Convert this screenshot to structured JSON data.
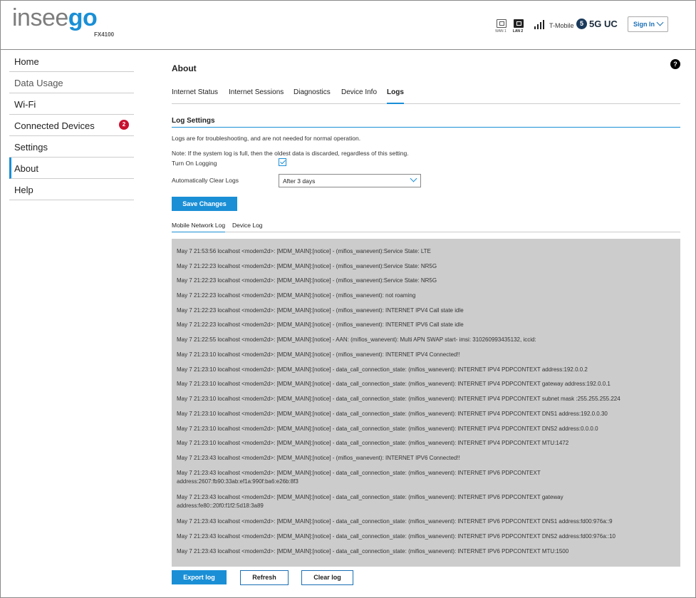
{
  "header": {
    "logo_part1": "insee",
    "logo_part2": "go",
    "model": "FX4100",
    "wan_label": "WAN 1",
    "lan_label": "LAN 2",
    "carrier": "T-Mobile",
    "network_icon_text": "5",
    "network_type": "5G UC",
    "sign_in": "Sign In"
  },
  "sidebar": {
    "items": [
      {
        "label": "Home"
      },
      {
        "label": "Data Usage"
      },
      {
        "label": "Wi-Fi"
      },
      {
        "label": "Connected Devices",
        "badge": "2"
      },
      {
        "label": "Settings"
      },
      {
        "label": "About"
      },
      {
        "label": "Help"
      }
    ]
  },
  "main": {
    "title": "About",
    "help": "?",
    "tabs": [
      "Internet Status",
      "Internet Sessions",
      "Diagnostics",
      "Device Info",
      "Logs"
    ],
    "section_title": "Log Settings",
    "note1": "Logs are for troubleshooting, and are not needed for normal operation.",
    "note2": "Note: If the system log is full, then the oldest data is discarded, regardless of this setting.",
    "logging_label": "Turn On Logging",
    "clear_label": "Automatically Clear Logs",
    "clear_value": "After 3 days",
    "save_button": "Save Changes",
    "log_tabs": [
      "Mobile Network Log",
      "Device Log"
    ],
    "log_lines": [
      "May 7 21:53:56 localhost <modem2d>: [MDM_MAIN]:[notice] - (mifios_wanevent):Service State: LTE",
      "May 7 21:22:23 localhost <modem2d>: [MDM_MAIN]:[notice] - (mifios_wanevent):Service State: NR5G",
      "May 7 21:22:23 localhost <modem2d>: [MDM_MAIN]:[notice] - (mifios_wanevent):Service State: NR5G",
      "May 7 21:22:23 localhost <modem2d>: [MDM_MAIN]:[notice] - (mifios_wanevent): not roaming",
      "May 7 21:22:23 localhost <modem2d>: [MDM_MAIN]:[notice] - (mifios_wanevent): INTERNET IPV4 Call state idle",
      "May 7 21:22:23 localhost <modem2d>: [MDM_MAIN]:[notice] - (mifios_wanevent): INTERNET IPV6 Call state idle",
      "May 7 21:22:55 localhost <modem2d>: [MDM_MAIN]:[notice] - AAN: (mifios_wanevent): Multi APN SWAP start- imsi: 310260993435132, iccid:",
      "May 7 21:23:10 localhost <modem2d>: [MDM_MAIN]:[notice] - (mifios_wanevent): INTERNET IPV4 Connected!!",
      "May 7 21:23:10 localhost <modem2d>: [MDM_MAIN]:[notice] - data_call_connection_state: (mifios_wanevent): INTERNET IPV4 PDPCONTEXT address:192.0.0.2",
      "May 7 21:23:10 localhost <modem2d>: [MDM_MAIN]:[notice] - data_call_connection_state: (mifios_wanevent): INTERNET IPV4 PDPCONTEXT gateway address:192.0.0.1",
      "May 7 21:23:10 localhost <modem2d>: [MDM_MAIN]:[notice] - data_call_connection_state: (mifios_wanevent): INTERNET IPV4 PDPCONTEXT subnet mask :255.255.255.224",
      "May 7 21:23:10 localhost <modem2d>: [MDM_MAIN]:[notice] - data_call_connection_state: (mifios_wanevent): INTERNET IPV4 PDPCONTEXT DNS1 address:192.0.0.30",
      "May 7 21:23:10 localhost <modem2d>: [MDM_MAIN]:[notice] - data_call_connection_state: (mifios_wanevent): INTERNET IPV4 PDPCONTEXT DNS2 address:0.0.0.0",
      "May 7 21:23:10 localhost <modem2d>: [MDM_MAIN]:[notice] - data_call_connection_state: (mifios_wanevent): INTERNET IPV4 PDPCONTEXT MTU:1472",
      "May 7 21:23:43 localhost <modem2d>: [MDM_MAIN]:[notice] - (mifios_wanevent): INTERNET IPV6 Connected!!",
      "May 7 21:23:43 localhost <modem2d>: [MDM_MAIN]:[notice] - data_call_connection_state: (mifios_wanevent): INTERNET IPV6 PDPCONTEXT\naddress:2607:fb90:33ab:ef1a:990f:ba6:e26b:8f3",
      "May 7 21:23:43 localhost <modem2d>: [MDM_MAIN]:[notice] - data_call_connection_state: (mifios_wanevent): INTERNET IPV6 PDPCONTEXT gateway\naddress:fe80::20f0:f1f2:5d18:3a89",
      "May 7 21:23:43 localhost <modem2d>: [MDM_MAIN]:[notice] - data_call_connection_state: (mifios_wanevent): INTERNET IPV6 PDPCONTEXT DNS1 address:fd00:976a::9",
      "May 7 21:23:43 localhost <modem2d>: [MDM_MAIN]:[notice] - data_call_connection_state: (mifios_wanevent): INTERNET IPV6 PDPCONTEXT DNS2 address:fd00:976a::10",
      "May 7 21:23:43 localhost <modem2d>: [MDM_MAIN]:[notice] - data_call_connection_state: (mifios_wanevent): INTERNET IPV6 PDPCONTEXT MTU:1500"
    ],
    "export_button": "Export log",
    "refresh_button": "Refresh",
    "clear_button": "Clear log"
  },
  "colors": {
    "accent": "#1a8fd6",
    "badge": "#c8102e",
    "log_background": "#cccccc"
  }
}
